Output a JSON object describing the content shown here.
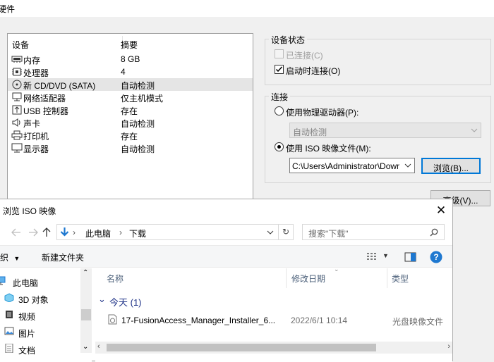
{
  "hw_window": {
    "title": "硬件",
    "device_list": {
      "col_device": "设备",
      "col_summary": "摘要",
      "rows": [
        {
          "name": "内存",
          "summary": "8 GB",
          "icon": "memory-icon"
        },
        {
          "name": "处理器",
          "summary": "4",
          "icon": "cpu-icon"
        },
        {
          "name": "新 CD/DVD (SATA)",
          "summary": "自动检测",
          "icon": "cd-icon",
          "selected": true
        },
        {
          "name": "网络适配器",
          "summary": "仅主机模式",
          "icon": "network-icon"
        },
        {
          "name": "USB 控制器",
          "summary": "存在",
          "icon": "usb-icon"
        },
        {
          "name": "声卡",
          "summary": "自动检测",
          "icon": "speaker-icon"
        },
        {
          "name": "打印机",
          "summary": "存在",
          "icon": "printer-icon"
        },
        {
          "name": "显示器",
          "summary": "自动检测",
          "icon": "monitor-icon"
        }
      ]
    },
    "device_status": {
      "label": "设备状态",
      "connected": "已连接(C)",
      "connect_at_power_on": "启动时连接(O)"
    },
    "connection": {
      "label": "连接",
      "use_physical": "使用物理驱动器(P):",
      "physical_value": "自动检测",
      "use_iso": "使用 ISO 映像文件(M):",
      "iso_path": "C:\\Users\\Administrator\\Dowr",
      "browse": "浏览(B)..."
    },
    "advanced": "高级(V)..."
  },
  "dialog": {
    "title": "浏览 ISO 映像",
    "breadcrumb": [
      "此电脑",
      "下载"
    ],
    "search_placeholder": "搜索\"下载\"",
    "organize": "组织",
    "new_folder": "新建文件夹",
    "nav_items": [
      {
        "label": "此电脑",
        "icon": "pc-icon"
      },
      {
        "label": "3D 对象",
        "icon": "3d-objects-icon"
      },
      {
        "label": "视频",
        "icon": "video-icon"
      },
      {
        "label": "图片",
        "icon": "pictures-icon"
      },
      {
        "label": "文档",
        "icon": "documents-icon"
      }
    ],
    "columns": {
      "name": "名称",
      "modified": "修改日期",
      "type": "类型"
    },
    "group": "今天 (1)",
    "files": [
      {
        "name": "17-FusionAccess_Manager_Installer_6...",
        "modified": "2022/6/1 10:14",
        "type": "光盘映像文件"
      }
    ]
  }
}
